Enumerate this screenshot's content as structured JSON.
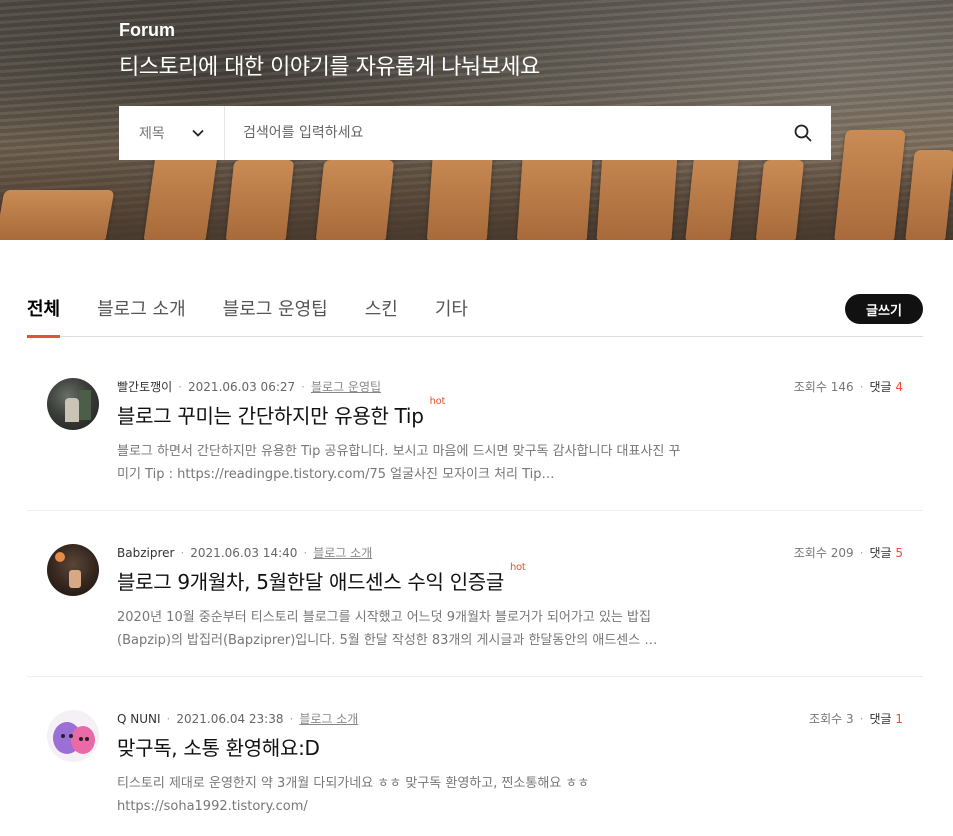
{
  "hero": {
    "label": "Forum",
    "title": "티스토리에 대한 이야기를 자유롭게 나눠보세요",
    "search": {
      "select_value": "제목",
      "placeholder": "검색어를 입력하세요"
    }
  },
  "tabs": [
    {
      "label": "전체",
      "active": true
    },
    {
      "label": "블로그 소개",
      "active": false
    },
    {
      "label": "블로그 운영팁",
      "active": false
    },
    {
      "label": "스킨",
      "active": false
    },
    {
      "label": "기타",
      "active": false
    }
  ],
  "write_button": "글쓰기",
  "colors": {
    "accent": "#e4532f",
    "dark": "#111111"
  },
  "posts": [
    {
      "author": "빨간토깽이",
      "date": "2021.06.03 06:27",
      "category": "블로그 운영팁",
      "views_label": "조회수 146",
      "comments_label": "댓글",
      "comments_count": "4",
      "title": "블로그 꾸미는 간단하지만 유용한 Tip",
      "hot": "hot",
      "excerpt": "블로그 하면서 간단하지만 유용한 Tip 공유합니다. 보시고 마음에 드시면 맞구독 감사합니다 대표사진 꾸미기 Tip : https://readingpe.tistory.com/75 얼굴사진 모자이크 처리 Tip…"
    },
    {
      "author": "Babziprer",
      "date": "2021.06.03 14:40",
      "category": "블로그 소개",
      "views_label": "조회수 209",
      "comments_label": "댓글",
      "comments_count": "5",
      "title": "블로그 9개월차, 5월한달 애드센스 수익 인증글",
      "hot": "hot",
      "excerpt": "2020년 10월 중순부터 티스토리 블로그를 시작했고 어느덧 9개월차 블로거가 되어가고 있는 밥집(Bapzip)의 밥집러(Bapziprer)입니다. 5월 한달 작성한 83개의 게시글과 한달동안의 애드센스 …"
    },
    {
      "author": "Q NUNI",
      "date": "2021.06.04 23:38",
      "category": "블로그 소개",
      "views_label": "조회수 3",
      "comments_label": "댓글",
      "comments_count": "1",
      "title": "맞구독, 소통 환영해요:D",
      "hot": "",
      "excerpt": "티스토리 제대로 운영한지 약 3개월 다되가네요 ㅎㅎ 맞구독 환영하고, 찐소통해요 ㅎㅎ https://soha1992.tistory.com/"
    }
  ]
}
